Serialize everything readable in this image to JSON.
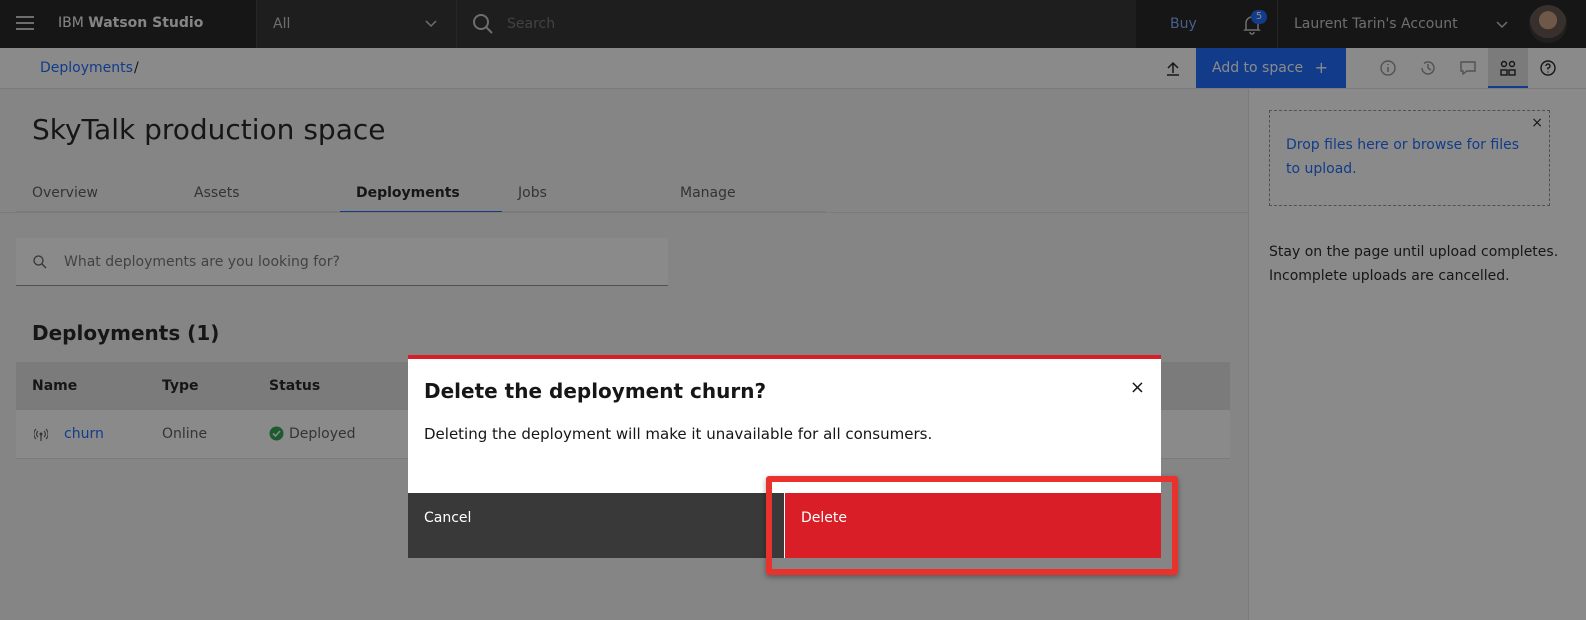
{
  "header": {
    "brand_prefix": "IBM",
    "brand_name": "Watson Studio",
    "scope_value": "All",
    "search_placeholder": "Search",
    "buy_label": "Buy",
    "notification_count": "5",
    "account_label": "Laurent Tarin's Account"
  },
  "subbar": {
    "breadcrumb": "Deployments",
    "breadcrumb_sep": "/",
    "add_to_space": "Add to space",
    "add_plus": "+"
  },
  "page": {
    "title": "SkyTalk production space",
    "tabs": [
      {
        "label": "Overview"
      },
      {
        "label": "Assets"
      },
      {
        "label": "Deployments"
      },
      {
        "label": "Jobs"
      },
      {
        "label": "Manage"
      }
    ],
    "search_placeholder": "What deployments are you looking for?",
    "section_title": "Deployments (1)",
    "table": {
      "headers": [
        "Name",
        "Type",
        "Status"
      ],
      "rows": [
        {
          "name": "churn",
          "type": "Online",
          "status": "Deployed"
        }
      ]
    }
  },
  "panel": {
    "dropzone_text": "Drop files here or browse for files to upload.",
    "close": "×",
    "note": "Stay on the page until upload completes. Incomplete uploads are cancelled."
  },
  "modal": {
    "title_prefix": "Delete the deployment ",
    "title_name": "churn",
    "title_suffix": "?",
    "close": "×",
    "body": "Deleting the deployment will make it unavailable for all consumers.",
    "cancel_label": "Cancel",
    "delete_label": "Delete"
  },
  "colors": {
    "primary": "#0f62fe",
    "danger": "#da1e28",
    "highlight": "#e8322b",
    "success": "#24a148"
  }
}
